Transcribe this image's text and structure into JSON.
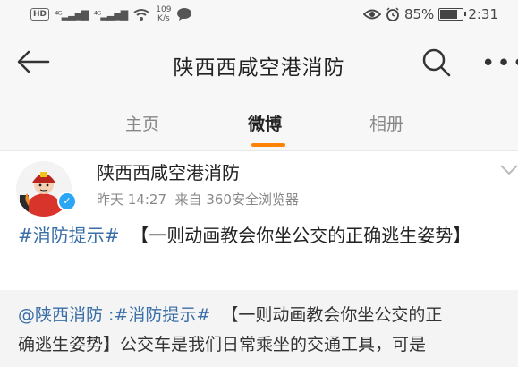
{
  "status_bar": {
    "hd": "HD",
    "signal_1": "⁴ᴳ",
    "signal_2": "⁴ᴳ",
    "net_speed_value": "109",
    "net_speed_unit": "K/s",
    "battery_percent": "85%",
    "time": "2:31",
    "battery_level": 0.85
  },
  "navbar": {
    "title": "陕西西咸空港消防"
  },
  "tabs": [
    {
      "label": "主页"
    },
    {
      "label": "微博",
      "active": true
    },
    {
      "label": "相册"
    }
  ],
  "post": {
    "author": "陕西西咸空港消防",
    "time": "昨天 14:27",
    "source": "来自 360安全浏览器",
    "hashtag": "#消防提示#",
    "text": "【一则动画教会你坐公交的正确逃生姿势】"
  },
  "retweet": {
    "mention": "@陕西消防",
    "sep": " :",
    "hashtag": "#消防提示#",
    "line1_text": "【一则动画教会你坐公交的正",
    "line2_text": "确逃生姿势】公交车是我们日常乘坐的交通工具，可是"
  },
  "colors": {
    "accent": "#ff8200",
    "link": "#3a6ea8",
    "verified": "#2aa6f5"
  }
}
